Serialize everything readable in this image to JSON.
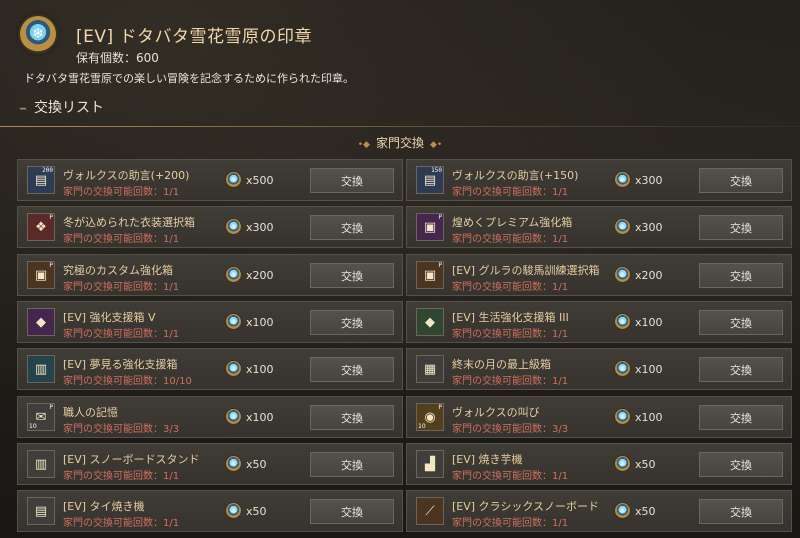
{
  "header": {
    "icon": "snowflake-seal-icon",
    "title": "[EV] ドタバタ雪花雪原の印章",
    "owned": "保有個数：600",
    "description": "ドタバタ雪花雪原での楽しい冒険を記念するために作られた印章。",
    "list_title": "交換リスト"
  },
  "section": {
    "title": "家門交換"
  },
  "colors": {
    "accent": "#f1d7ad",
    "limit": "#d0705e",
    "row_bg": "#3b3833"
  },
  "exchange_label": "交換",
  "items": [
    {
      "name": "ヴォルクスの助言(+200)",
      "limit": "家門の交換可能回数：1/1",
      "cost": "x500",
      "icon": "volks-advice-200-icon",
      "corner": "200",
      "count": "",
      "glyph": "▤",
      "color": "c-blue"
    },
    {
      "name": "ヴォルクスの助言(+150)",
      "limit": "家門の交換可能回数：1/1",
      "cost": "x300",
      "icon": "volks-advice-150-icon",
      "corner": "150",
      "count": "",
      "glyph": "▤",
      "color": "c-blue"
    },
    {
      "name": "冬が込められた衣装選択箱",
      "limit": "家門の交換可能回数：1/1",
      "cost": "x300",
      "icon": "outfit-box-icon",
      "corner": "P",
      "count": "",
      "glyph": "❖",
      "color": "c-red"
    },
    {
      "name": "煌めくプレミアム強化箱",
      "limit": "家門の交換可能回数：1/1",
      "cost": "x300",
      "icon": "premium-box-icon",
      "corner": "P",
      "count": "",
      "glyph": "▣",
      "color": "c-purple"
    },
    {
      "name": "究極のカスタム強化箱",
      "limit": "家門の交換可能回数：1/1",
      "cost": "x200",
      "icon": "custom-box-icon",
      "corner": "P",
      "count": "",
      "glyph": "▣",
      "color": "c-brown"
    },
    {
      "name": "[EV] グルラの駿馬訓練選択箱",
      "limit": "家門の交換可能回数：1/1",
      "cost": "x200",
      "icon": "horse-training-box-icon",
      "corner": "P",
      "count": "",
      "glyph": "▣",
      "color": "c-brown"
    },
    {
      "name": "[EV] 強化支援箱 V",
      "limit": "家門の交換可能回数：1/1",
      "cost": "x100",
      "icon": "support-box-v-icon",
      "corner": "",
      "count": "",
      "glyph": "◆",
      "color": "c-purple"
    },
    {
      "name": "[EV] 生活強化支援箱 III",
      "limit": "家門の交換可能回数：1/1",
      "cost": "x100",
      "icon": "life-support-box-icon",
      "corner": "",
      "count": "",
      "glyph": "◆",
      "color": "c-green"
    },
    {
      "name": "[EV] 夢見る強化支援箱",
      "limit": "家門の交換可能回数：10/10",
      "cost": "x100",
      "icon": "dream-support-box-icon",
      "corner": "",
      "count": "",
      "glyph": "▥",
      "color": "c-teal"
    },
    {
      "name": "終末の月の最上級箱",
      "limit": "家門の交換可能回数：1/1",
      "cost": "x100",
      "icon": "moon-box-icon",
      "corner": "",
      "count": "",
      "glyph": "▦",
      "color": "c-gray"
    },
    {
      "name": "職人の記憶",
      "limit": "家門の交換可能回数：3/3",
      "cost": "x100",
      "icon": "artisan-memory-icon",
      "corner": "P",
      "count": "10",
      "glyph": "✉",
      "color": "c-gray"
    },
    {
      "name": "ヴォルクスの叫び",
      "limit": "家門の交換可能回数：3/3",
      "cost": "x100",
      "icon": "volks-cry-icon",
      "corner": "P",
      "count": "10",
      "glyph": "◉",
      "color": "c-gold"
    },
    {
      "name": "[EV] スノーボードスタンド",
      "limit": "家門の交換可能回数：1/1",
      "cost": "x50",
      "icon": "snowboard-stand-icon",
      "corner": "",
      "count": "",
      "glyph": "▥",
      "color": "c-gray"
    },
    {
      "name": "[EV] 焼き芋機",
      "limit": "家門の交換可能回数：1/1",
      "cost": "x50",
      "icon": "sweet-potato-roaster-icon",
      "corner": "",
      "count": "",
      "glyph": "▟",
      "color": "c-gray"
    },
    {
      "name": "[EV] タイ焼き機",
      "limit": "家門の交換可能回数：1/1",
      "cost": "x50",
      "icon": "taiyaki-machine-icon",
      "corner": "",
      "count": "",
      "glyph": "▤",
      "color": "c-gray"
    },
    {
      "name": "[EV] クラシックスノーボード",
      "limit": "家門の交換可能回数：1/1",
      "cost": "x50",
      "icon": "snowboard-icon",
      "corner": "",
      "count": "",
      "glyph": "⟋",
      "color": "c-brown"
    }
  ]
}
